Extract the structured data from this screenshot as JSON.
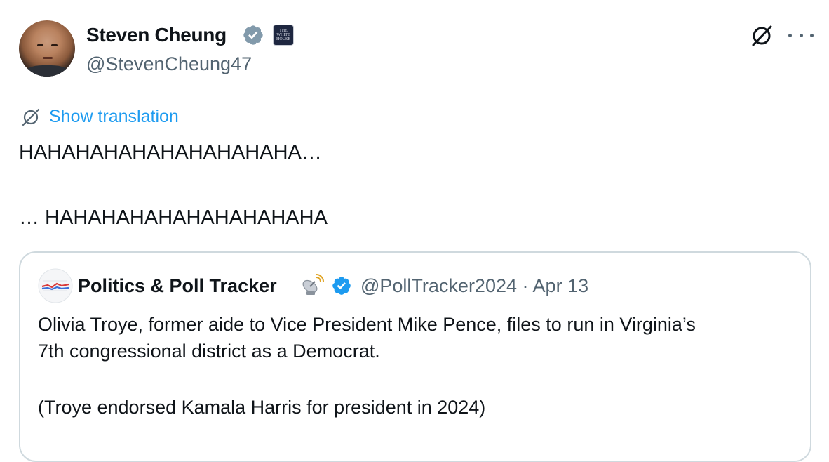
{
  "tweet": {
    "author": {
      "name": "Steven Cheung",
      "handle": "@StevenCheung47",
      "avatar_icon": "profile-photo",
      "verified_icon": "verified-badge-gray",
      "affiliation_badge": {
        "icon": "white-house-badge",
        "text": "THE WHITE HOUSE"
      }
    },
    "actions": {
      "grok_icon": "grok-icon",
      "more_icon": "more-icon"
    },
    "translate": {
      "label": "Show translation",
      "icon": "translate-icon"
    },
    "text_line_1": "HAHAHAHAHAHAHAHAHAHA…",
    "text_line_2": "… HAHAHAHAHAHAHAHAHAHA"
  },
  "quoted_tweet": {
    "author": {
      "name": "Politics & Poll Tracker",
      "emoji_icon": "satellite-antenna-icon",
      "verified_icon": "verified-badge-blue",
      "handle": "@PollTracker2024",
      "separator": "·",
      "date": "Apr 13"
    },
    "text_line_1": "Olivia Troye, former aide to Vice President Mike Pence, files to run in Virginia’s",
    "text_line_2": "7th congressional district as a Democrat.",
    "text_line_3": "(Troye endorsed Kamala Harris for president in 2024)"
  },
  "colors": {
    "text": "#0f1419",
    "secondary": "#536471",
    "link": "#1d9bf0",
    "border": "#cfd9de",
    "verified_gray": "#829aab",
    "verified_blue": "#1d9bf0"
  }
}
